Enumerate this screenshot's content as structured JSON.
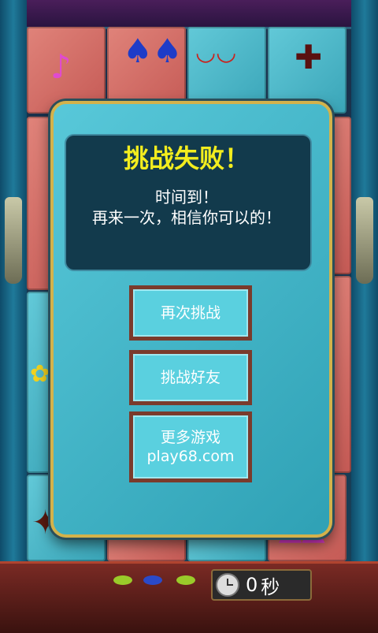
{
  "dialog": {
    "title": "挑战失败！",
    "line1": "时间到！",
    "line2": "再来一次，相信你可以的！",
    "buttons": {
      "retry": "再次挑战",
      "challenge_friend": "挑战好友",
      "more_games": "更多游戏",
      "more_games_site": "play68.com"
    }
  },
  "timer": {
    "value": "0",
    "unit": "秒"
  },
  "colors": {
    "title": "#f3ed1e",
    "dialog_bg": "#3fb2c5",
    "dialog_border": "#d3b24b",
    "button_border": "#7a3b2c"
  },
  "icons": [
    "clock-icon",
    "note-icon",
    "tulip-icon",
    "lips-icon",
    "cross-icon",
    "leaf-icon",
    "flower-icon",
    "triangle-icon"
  ]
}
